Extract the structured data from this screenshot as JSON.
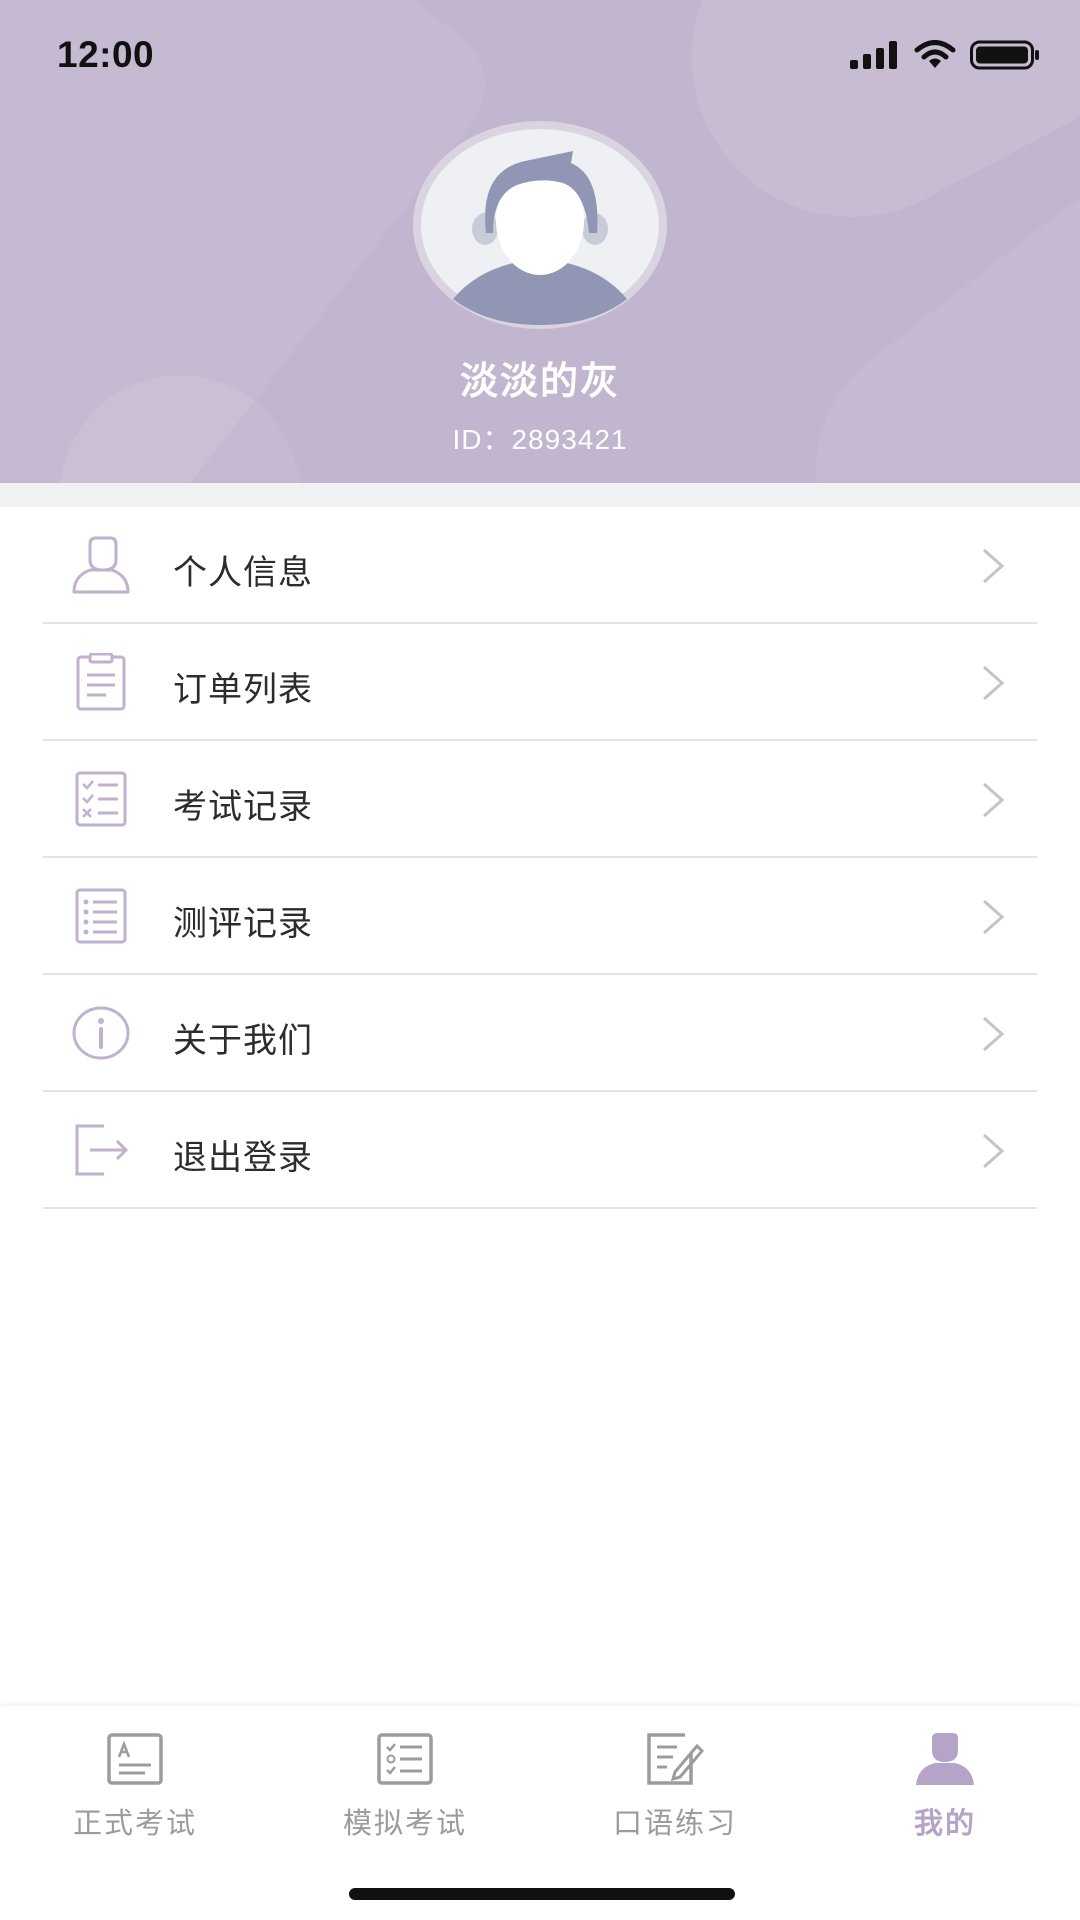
{
  "status_bar": {
    "time": "12:00",
    "icons": [
      "signal-icon",
      "wifi-icon",
      "battery-icon"
    ]
  },
  "profile": {
    "name": "淡淡的灰",
    "id_label": "ID：2893421"
  },
  "menu": {
    "items": [
      {
        "label": "个人信息",
        "icon": "person-icon"
      },
      {
        "label": "订单列表",
        "icon": "clipboard-icon"
      },
      {
        "label": "考试记录",
        "icon": "checklist-icon"
      },
      {
        "label": "测评记录",
        "icon": "list-icon"
      },
      {
        "label": "关于我们",
        "icon": "info-icon"
      },
      {
        "label": "退出登录",
        "icon": "logout-icon"
      }
    ]
  },
  "tabbar": {
    "tabs": [
      {
        "label": "正式考试",
        "icon": "exam-paper-icon",
        "active": false
      },
      {
        "label": "模拟考试",
        "icon": "mock-exam-icon",
        "active": false
      },
      {
        "label": "口语练习",
        "icon": "speaking-practice-icon",
        "active": false
      },
      {
        "label": "我的",
        "icon": "profile-icon",
        "active": true
      }
    ]
  },
  "colors": {
    "header_bg": "#c2b5cf",
    "accent": "#b5a4c8",
    "icon_stroke": "#bfb1cf",
    "inactive_tab": "#9c9c9c"
  }
}
